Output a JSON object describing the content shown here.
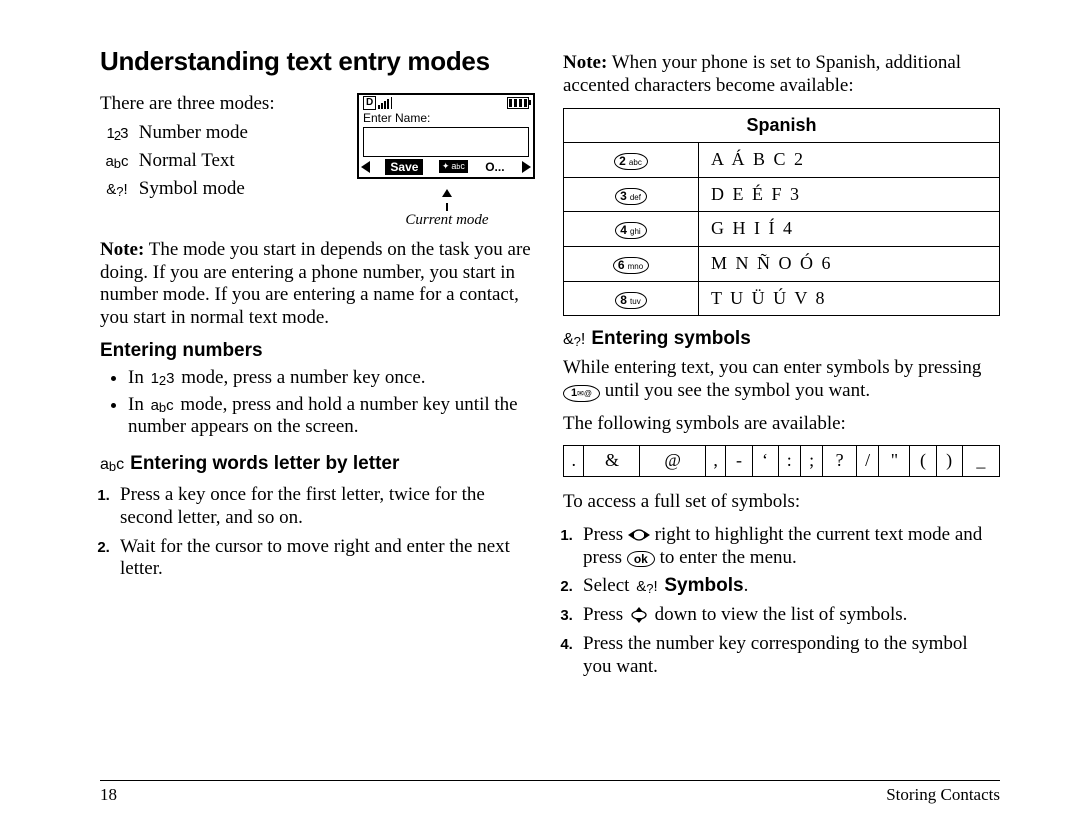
{
  "title": "Understanding text entry modes",
  "left": {
    "introLine": "There are three modes:",
    "modes": {
      "number": {
        "icon": "1₂3",
        "label": "Number mode"
      },
      "normal": {
        "icon": "abc",
        "label": "Normal Text"
      },
      "symbol": {
        "icon": "&₂!",
        "label": "Symbol mode"
      }
    },
    "screen": {
      "statusD": "D",
      "enterLabel": "Enter Name:",
      "saveLabel": "Save",
      "rightSoft": "O...",
      "currentModeCaption": "Current mode"
    },
    "noteLead": "Note:",
    "noteBody": " The mode you start in depends on the task you are doing. If you are entering a phone number, you start in number mode. If you are entering a name for a contact, you start in normal text mode.",
    "enterNumbersHeading": "Entering numbers",
    "bullets": {
      "b1a": "In ",
      "b1b": "1₂3",
      "b1c": "  mode, press a number key once.",
      "b2a": "In ",
      "b2b": "abc",
      "b2c": " mode, press and hold a number key until the number appears on the screen."
    },
    "wordsHeading": "Entering words letter by letter",
    "wordsIcon": "abc",
    "steps": {
      "s1": "Press a key once for the first letter, twice for the second letter, and so on.",
      "s2": "Wait for the cursor to move right and enter the next letter."
    }
  },
  "right": {
    "noteLead": "Note:",
    "noteBody": " When your phone is set to Spanish, additional accented characters become available:",
    "tableHeader": "Spanish",
    "rows": [
      {
        "keyNum": "2",
        "keyLetters": "abc",
        "letters": "A Á B C 2"
      },
      {
        "keyNum": "3",
        "keyLetters": "def",
        "letters": "D E É F 3"
      },
      {
        "keyNum": "4",
        "keyLetters": "ghi",
        "letters": "G H I Í 4"
      },
      {
        "keyNum": "6",
        "keyLetters": "mno",
        "letters": "M N Ñ O Ó 6"
      },
      {
        "keyNum": "8",
        "keyLetters": "tuv",
        "letters": "T U Ü Ú V 8"
      }
    ],
    "symHeadingIcon": "&₂!",
    "symHeading": "Entering symbols",
    "symBody1a": "While entering text, you can enter symbols by pressing ",
    "symKey1Num": "1",
    "symKey1Icon": "✉@",
    "symBody1b": " until you see the symbol you want.",
    "symAvail": "The following symbols are available:",
    "symbols": [
      ".",
      "&",
      "@",
      ",",
      "-",
      "‘",
      ":",
      ";",
      "?",
      "/",
      "\"",
      "(",
      ")",
      "_"
    ],
    "access": "To access a full set of symbols:",
    "steps": {
      "s1a": "Press ",
      "s1b": " right to highlight the current text mode and press ",
      "s1ok": "ok",
      "s1c": " to enter the menu.",
      "s2a": "Select ",
      "s2icon": "&₂!",
      "s2b": "Symbols",
      "s2c": ".",
      "s3a": "Press ",
      "s3b": " down to view the list of symbols.",
      "s4": "Press the number key corresponding to the symbol you want."
    }
  },
  "footer": {
    "page": "18",
    "section": "Storing Contacts"
  }
}
